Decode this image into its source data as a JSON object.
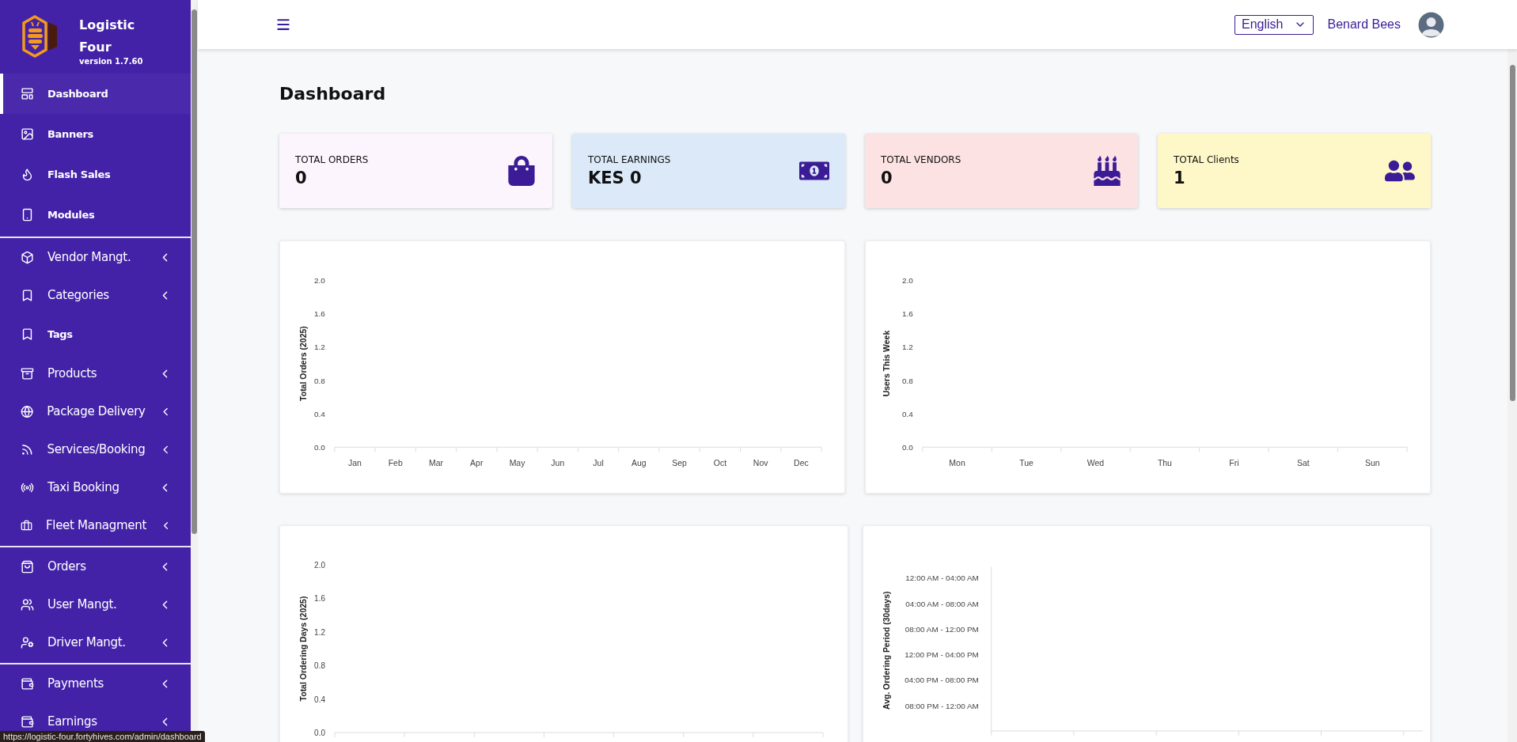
{
  "brand": {
    "name": "Logistic Four",
    "version": "version 1.7.60"
  },
  "sidebar": {
    "sections": [
      {
        "items": [
          {
            "label": "Dashboard",
            "kind": "link",
            "selected": true
          },
          {
            "label": "Banners",
            "kind": "link",
            "selected": false
          },
          {
            "label": "Flash Sales",
            "kind": "link",
            "selected": false
          },
          {
            "label": "Modules",
            "kind": "link",
            "selected": false
          }
        ]
      },
      {
        "items": [
          {
            "label": "Vendor Mangt.",
            "kind": "menu",
            "selected": false
          },
          {
            "label": "Categories",
            "kind": "menu",
            "selected": false
          },
          {
            "label": "Tags",
            "kind": "link",
            "selected": false
          },
          {
            "label": "Products",
            "kind": "menu",
            "selected": false
          },
          {
            "label": "Package Delivery",
            "kind": "menu",
            "selected": false
          },
          {
            "label": "Services/Booking",
            "kind": "menu",
            "selected": false
          },
          {
            "label": "Taxi Booking",
            "kind": "menu",
            "selected": false
          },
          {
            "label": "Fleet Managment",
            "kind": "menu",
            "selected": false
          }
        ]
      },
      {
        "items": [
          {
            "label": "Orders",
            "kind": "menu",
            "selected": false
          },
          {
            "label": "User Mangt.",
            "kind": "menu",
            "selected": false
          },
          {
            "label": "Driver Mangt.",
            "kind": "menu",
            "selected": false
          }
        ]
      },
      {
        "items": [
          {
            "label": "Payments",
            "kind": "menu",
            "selected": false
          },
          {
            "label": "Earnings",
            "kind": "menu",
            "selected": false
          }
        ]
      }
    ]
  },
  "header": {
    "language": "English",
    "user_name": "Benard Bees"
  },
  "page_title": "Dashboard",
  "stats": [
    {
      "label": "TOTAL ORDERS",
      "value": "0",
      "color": "#fdf5fd"
    },
    {
      "label": "TOTAL EARNINGS",
      "value": "KES 0",
      "color": "#dbe9f8"
    },
    {
      "label": "TOTAL VENDORS",
      "value": "0",
      "color": "#fde2e3"
    },
    {
      "label": "TOTAL Clients",
      "value": "1",
      "color": "#fef8c8"
    }
  ],
  "charts": [
    {
      "chart_data": {
        "type": "bar",
        "ylabel": "Total Orders (2025)",
        "categories": [
          "Jan",
          "Feb",
          "Mar",
          "Apr",
          "May",
          "Jun",
          "Jul",
          "Aug",
          "Sep",
          "Oct",
          "Nov",
          "Dec"
        ],
        "ylim": [
          0,
          2
        ],
        "yticks": [
          {
            "value": 0,
            "label": "0.0"
          },
          {
            "value": 0.4,
            "label": "0.4"
          },
          {
            "value": 0.8,
            "label": "0.8"
          },
          {
            "value": 1.2,
            "label": "1.2"
          },
          {
            "value": 1.6,
            "label": "1.6"
          },
          {
            "value": 2,
            "label": "2.0"
          }
        ]
      }
    },
    {
      "chart_data": {
        "type": "bar",
        "ylabel": "Users This Week",
        "categories": [
          "Mon",
          "Tue",
          "Wed",
          "Thu",
          "Fri",
          "Sat",
          "Sun"
        ],
        "ylim": [
          0,
          2
        ],
        "yticks": [
          {
            "value": 0,
            "label": "0.0"
          },
          {
            "value": 0.4,
            "label": "0.4"
          },
          {
            "value": 0.8,
            "label": "0.8"
          },
          {
            "value": 1.2,
            "label": "1.2"
          },
          {
            "value": 1.6,
            "label": "1.6"
          },
          {
            "value": 2,
            "label": "2.0"
          }
        ]
      }
    },
    {
      "chart_data": {
        "type": "bar",
        "ylabel": "Total Ordering Days (2025)",
        "categories": [
          null,
          null,
          null,
          null,
          null,
          null,
          null
        ],
        "ylim": [
          0,
          2
        ],
        "yticks": [
          {
            "value": 0,
            "label": "0.0"
          },
          {
            "value": 0.4,
            "label": "0.4"
          },
          {
            "value": 0.8,
            "label": "0.8"
          },
          {
            "value": 1.2,
            "label": "1.2"
          },
          {
            "value": 1.6,
            "label": "1.6"
          },
          {
            "value": 2,
            "label": "2.0"
          }
        ]
      }
    },
    {
      "chart_data": {
        "type": "other",
        "ylabel": "Avg. Ordering Period (30days)",
        "categories": [
          "12:00 AM - 04:00 AM",
          "04:00 AM - 08:00 AM",
          "08:00 AM - 12:00 PM",
          "12:00 PM - 04:00 PM",
          "04:00 PM - 08:00 PM",
          "08:00 PM - 12:00 AM"
        ]
      }
    }
  ],
  "status_bar": {
    "url": "https://logistic-four.fortyhives.com/admin/dashboard"
  }
}
